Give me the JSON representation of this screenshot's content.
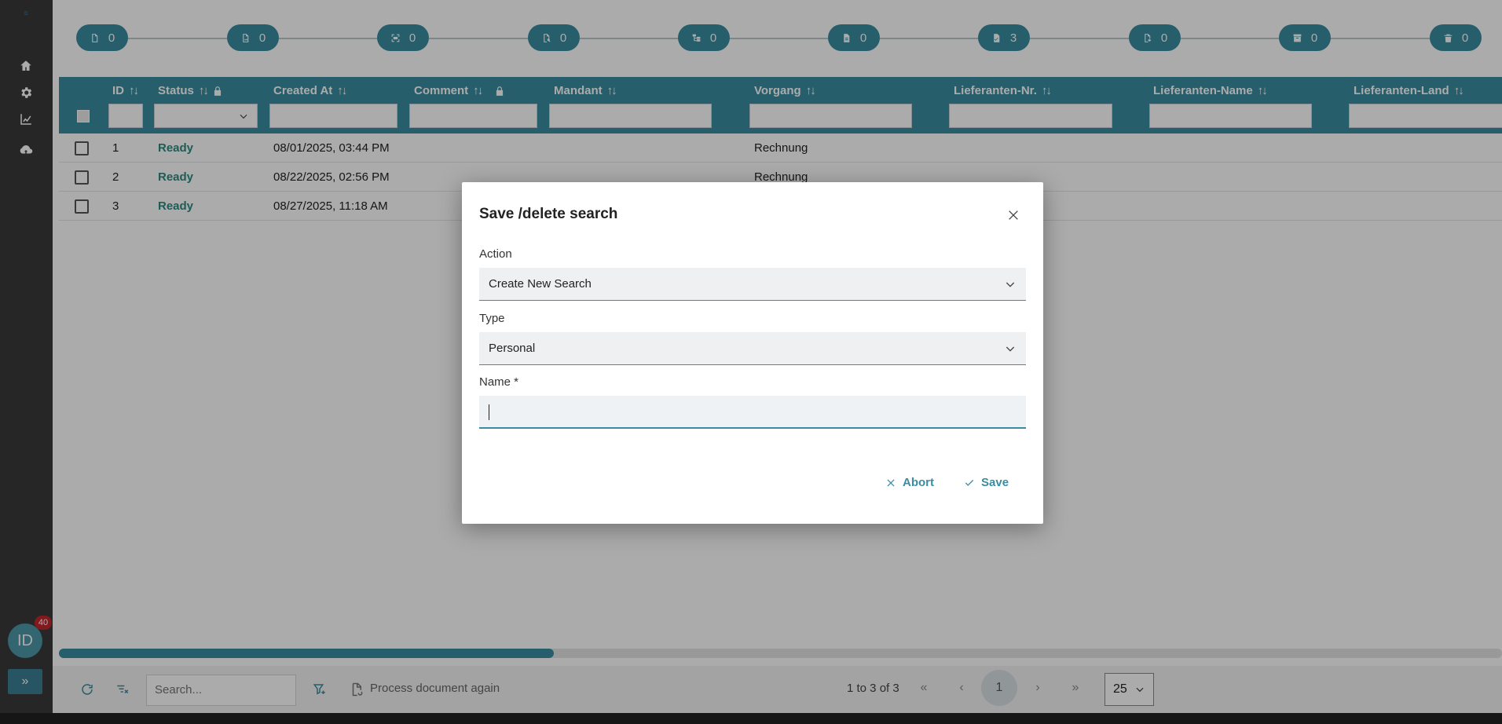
{
  "sidebar": {
    "avatar_initials": "ID",
    "avatar_badge": "40",
    "expand_label": "»",
    "icons": [
      "home-icon",
      "gear-icon",
      "chart-icon",
      "cloud-upload-icon"
    ]
  },
  "stepper": {
    "steps": [
      {
        "icon": "document-icon",
        "count": "0"
      },
      {
        "icon": "image-document-icon",
        "count": "0"
      },
      {
        "icon": "scan-icon",
        "count": "0"
      },
      {
        "icon": "document-search-icon",
        "count": "0"
      },
      {
        "icon": "tree-icon",
        "count": "0"
      },
      {
        "icon": "document-text-icon",
        "count": "0"
      },
      {
        "icon": "document-check-icon",
        "count": "3"
      },
      {
        "icon": "document-export-icon",
        "count": "0"
      },
      {
        "icon": "archive-icon",
        "count": "0"
      },
      {
        "icon": "trash-icon",
        "count": "0"
      }
    ]
  },
  "table": {
    "columns": {
      "id": "ID",
      "status": "Status",
      "created_at": "Created At",
      "comment": "Comment",
      "mandant": "Mandant",
      "vorgang": "Vorgang",
      "lieferanten_nr": "Lieferanten-Nr.",
      "lieferanten_name": "Lieferanten-Name",
      "lieferanten_land": "Lieferanten-Land"
    },
    "sort_glyph": "↑↓",
    "rows": [
      {
        "id": "1",
        "status": "Ready",
        "created_at": "08/01/2025, 03:44 PM",
        "vorgang": "Rechnung"
      },
      {
        "id": "2",
        "status": "Ready",
        "created_at": "08/22/2025, 02:56 PM",
        "vorgang": "Rechnung"
      },
      {
        "id": "3",
        "status": "Ready",
        "created_at": "08/27/2025, 11:18 AM",
        "vorgang": ""
      }
    ]
  },
  "footer": {
    "search_placeholder": "Search...",
    "process_again_label": "Process document again",
    "pagination_summary": "1 to 3 of 3",
    "current_page": "1",
    "page_size": "25",
    "first_glyph": "«",
    "prev_glyph": "‹",
    "next_glyph": "›",
    "last_glyph": "»"
  },
  "dialog": {
    "title": "Save /delete search",
    "action_label": "Action",
    "action_value": "Create New Search",
    "type_label": "Type",
    "type_value": "Personal",
    "name_label": "Name *",
    "name_value": "",
    "abort_label": "Abort",
    "save_label": "Save"
  },
  "colors": {
    "accent": "#3a8da0",
    "ready": "#2f8a80",
    "sidebar": "#3a3a3a",
    "badge": "#c0262d"
  }
}
